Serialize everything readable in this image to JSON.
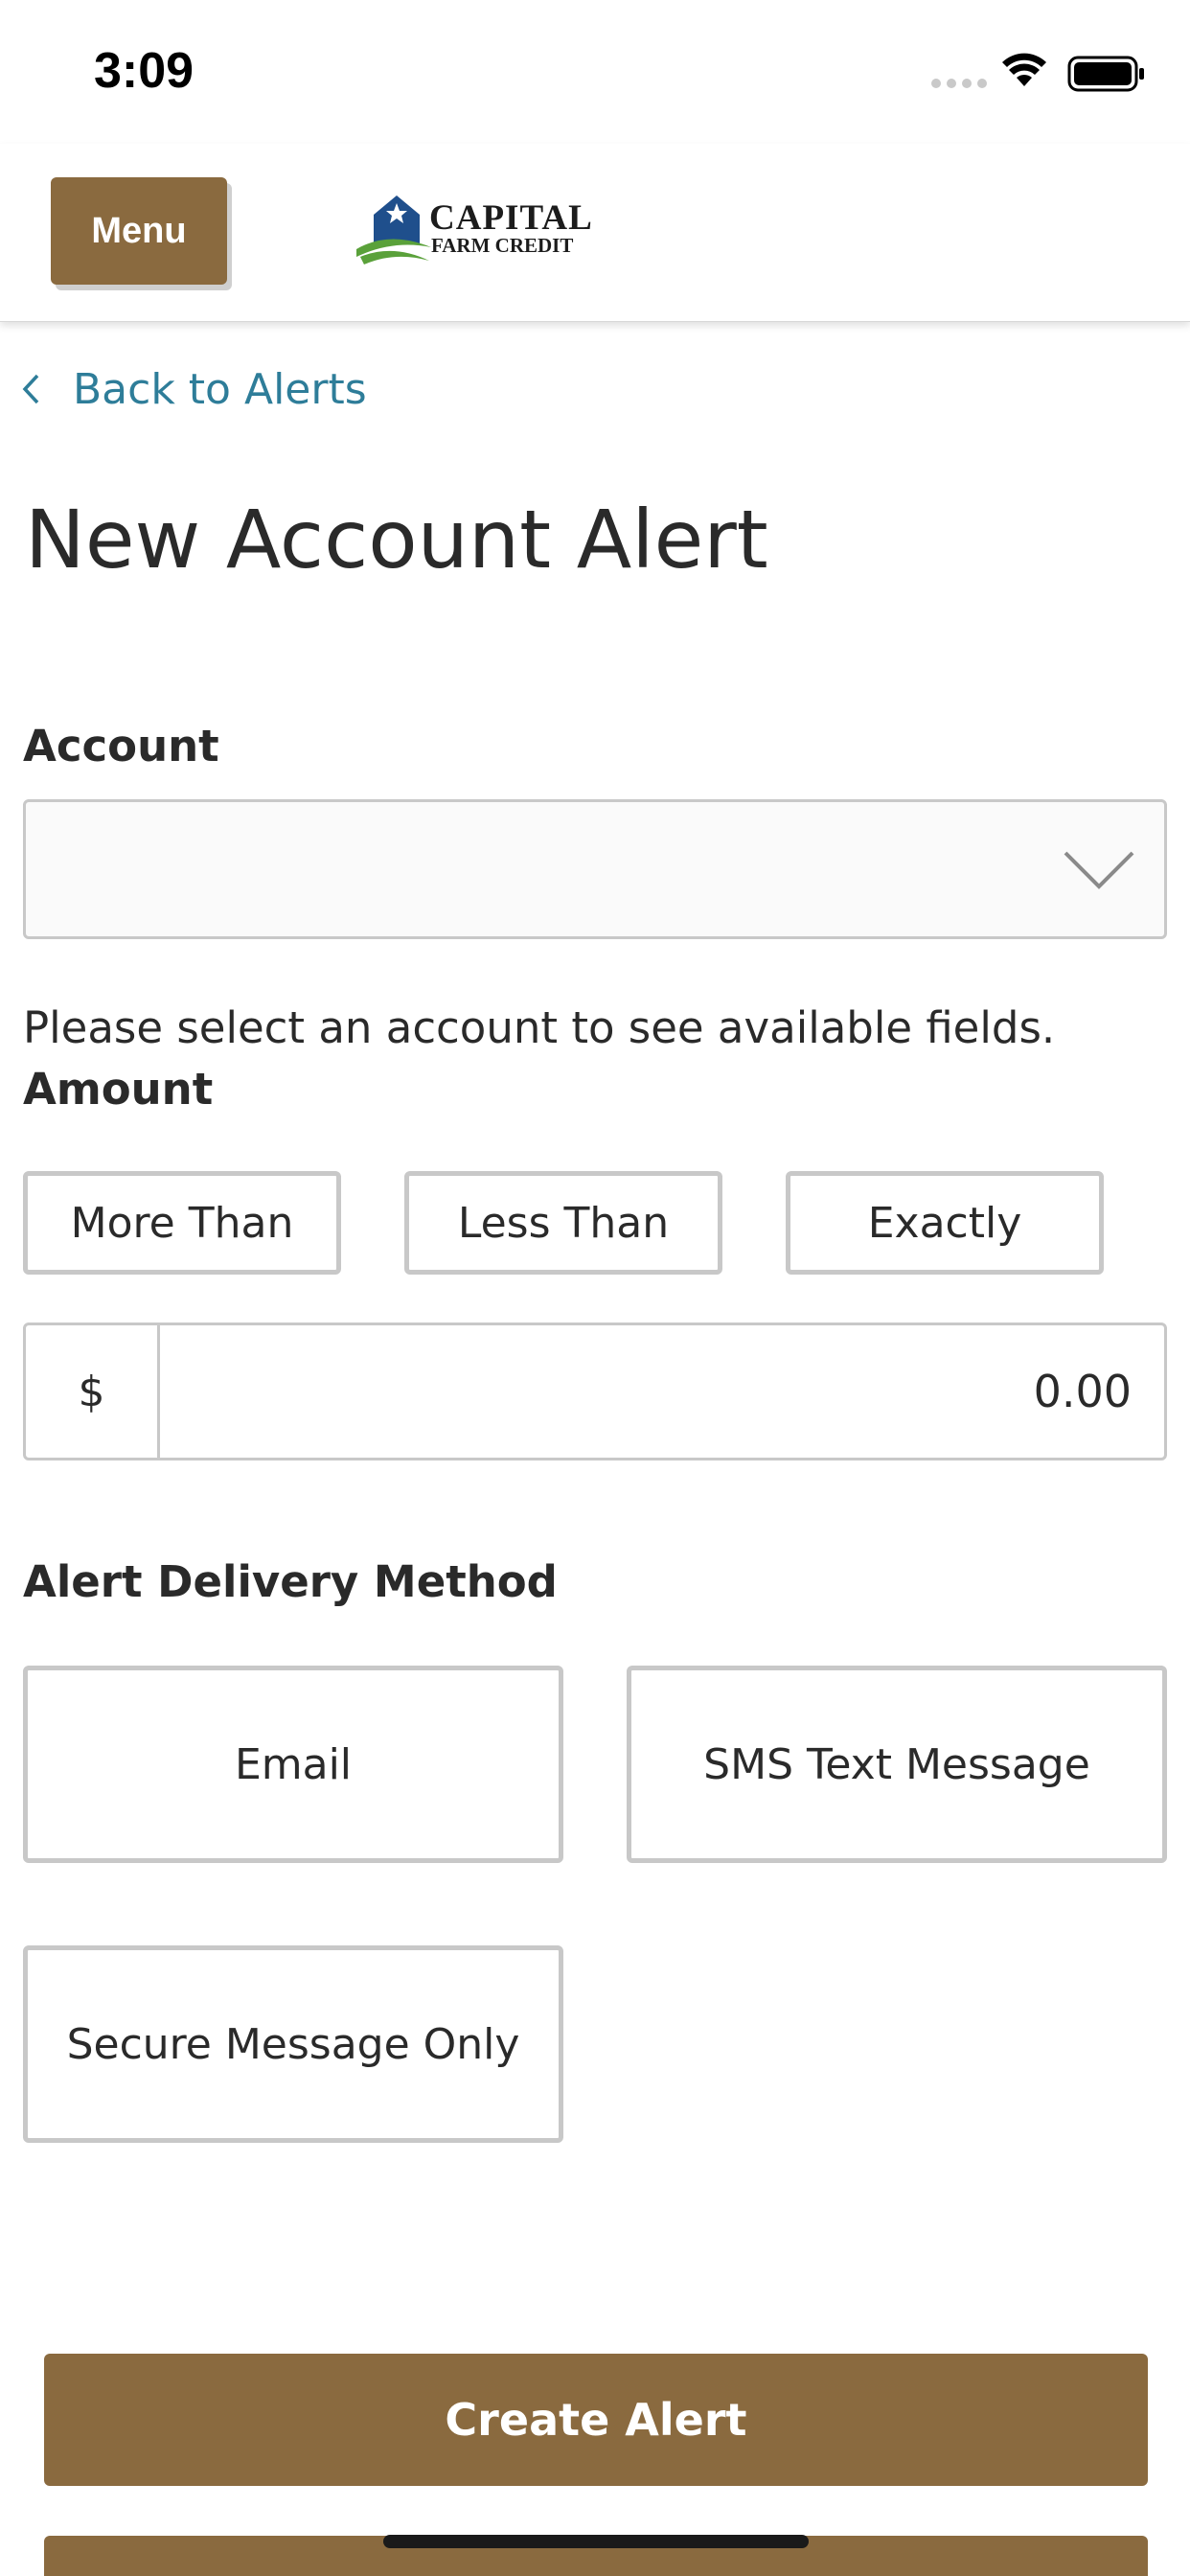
{
  "status_bar": {
    "time": "3:09",
    "icons": [
      "cellular-signal-icon",
      "wifi-icon",
      "battery-icon"
    ]
  },
  "header": {
    "menu_label": "Menu",
    "logo": {
      "line1": "CAPITAL",
      "line2": "FARM CREDIT"
    }
  },
  "back_link": {
    "label": "Back to Alerts",
    "icon": "chevron-left-icon"
  },
  "title": "New Account Alert",
  "account": {
    "label": "Account",
    "selected_value": "",
    "icon": "chevron-down-icon",
    "help_text": "Please select an account to see available fields."
  },
  "amount": {
    "label": "Amount",
    "comparisons": [
      "More Than",
      "Less Than",
      "Exactly"
    ],
    "currency_symbol": "$",
    "value": "0.00"
  },
  "delivery": {
    "label": "Alert Delivery Method",
    "options": [
      "Email",
      "SMS Text Message",
      "Secure Message Only"
    ]
  },
  "actions": {
    "create_label": "Create Alert"
  },
  "colors": {
    "brand": "#8a6a3f",
    "link": "#2e7d99",
    "border": "#c8c8c8"
  }
}
